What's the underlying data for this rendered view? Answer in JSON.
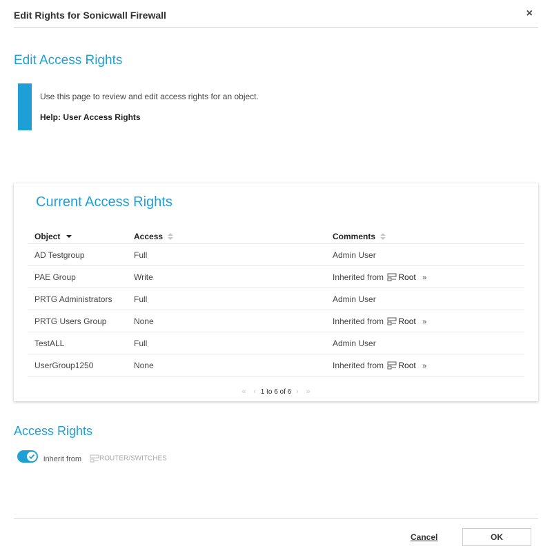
{
  "dialog": {
    "title": "Edit Rights for Sonicwall Firewall",
    "close_label": "×"
  },
  "edit_section": {
    "title": "Edit Access Rights",
    "info_text": "Use this page to review and edit access rights for an object.",
    "help_link": "Help: User Access Rights"
  },
  "current": {
    "title": "Current Access Rights",
    "columns": {
      "object": "Object",
      "access": "Access",
      "comments": "Comments"
    },
    "rows": [
      {
        "object": "AD Testgroup",
        "access": "Full",
        "comment": "Admin User"
      },
      {
        "object": "PAE Group",
        "access": "Write",
        "comment": "Inherited from",
        "link": "Root"
      },
      {
        "object": "PRTG Administrators",
        "access": "Full",
        "comment": "Admin User"
      },
      {
        "object": "PRTG Users Group",
        "access": "None",
        "comment": "Inherited from",
        "link": "Root"
      },
      {
        "object": "TestALL",
        "access": "Full",
        "comment": "Admin User"
      },
      {
        "object": "UserGroup1250",
        "access": "None",
        "comment": "Inherited from",
        "link": "Root"
      }
    ],
    "chevron": "»",
    "pager": {
      "first": "«",
      "prev": "‹",
      "text": "1 to 6 of 6",
      "next": "›",
      "last": "»"
    }
  },
  "access_rights": {
    "title": "Access Rights",
    "inherit_label": "inherit from",
    "inherit_target": "ROUTER/SWITCHES",
    "toggle_on": true
  },
  "footer": {
    "cancel_label": "Cancel",
    "ok_label": "OK"
  },
  "colors": {
    "accent": "#1ea0d6"
  },
  "icons": {
    "close": "close-icon",
    "sort_desc": "sort-desc-icon",
    "sort": "sort-icon",
    "group": "group-icon",
    "check": "check-icon"
  }
}
